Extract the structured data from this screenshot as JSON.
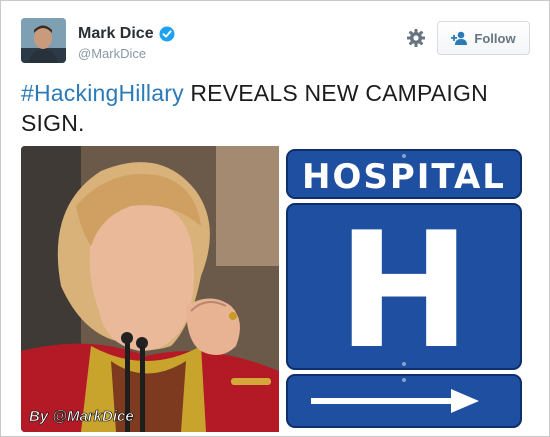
{
  "user": {
    "display_name": "Mark Dice",
    "handle": "@MarkDice",
    "verified": true
  },
  "actions": {
    "follow_label": "Follow"
  },
  "tweet": {
    "hashtag": "#HackingHillary",
    "text": " REVEALS NEW CAMPAIGN SIGN."
  },
  "media": {
    "sign_title": "HOSPITAL",
    "sign_letter": "H",
    "watermark": "By @MarkDice"
  },
  "icons": {
    "verified": "verified-badge-icon",
    "settings": "gear-icon",
    "follow": "add-user-icon"
  },
  "colors": {
    "link": "#2b7bb9",
    "sign_blue": "#1f4fa0",
    "verified": "#1da1f2"
  }
}
